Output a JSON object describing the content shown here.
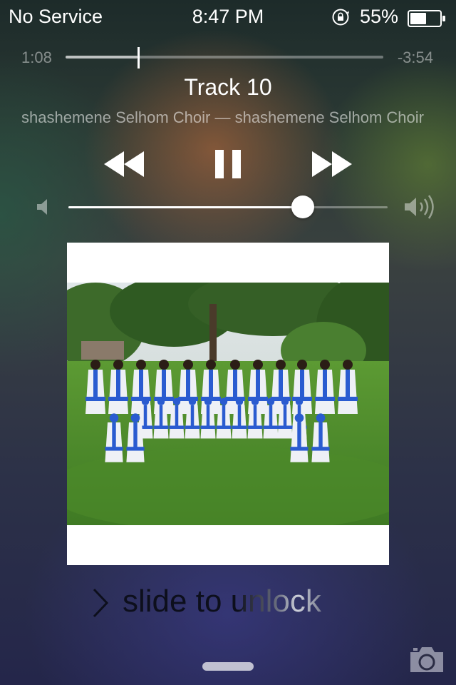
{
  "status_bar": {
    "carrier": "No Service",
    "time": "8:47 PM",
    "battery_percent": "55%",
    "battery_level": 0.55,
    "icons": [
      "orientation-lock-icon",
      "battery-icon"
    ]
  },
  "now_playing": {
    "elapsed": "1:08",
    "remaining": "-3:54",
    "progress": 0.227,
    "title": "Track 10",
    "subtitle": "shashemene Selhom Choir — shashemene Selhom Choir",
    "controls": {
      "previous": "rewind-icon",
      "play_pause": "pause-icon",
      "next": "fast-forward-icon"
    },
    "volume": 0.735,
    "artwork": "choir-group-photo"
  },
  "lock_screen": {
    "unlock_label": "slide to unlock",
    "camera": "camera-icon"
  },
  "colors": {
    "robe_blue": "#2a5bd0",
    "robe_white": "#eef0f6",
    "grass": "#4f8a2c"
  }
}
